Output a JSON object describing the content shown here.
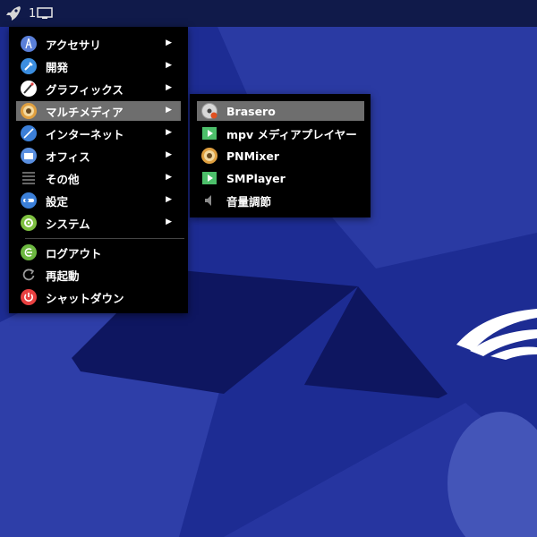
{
  "panel": {
    "launcher_icon": "rocket-icon",
    "workspace_number": "1",
    "workspace_icon": "monitor-icon"
  },
  "main_menu": {
    "items": [
      {
        "label": "アクセサリ",
        "icon": "accessories-compass-icon",
        "has_submenu": true
      },
      {
        "label": "開発",
        "icon": "development-hammer-icon",
        "has_submenu": true
      },
      {
        "label": "グラフィックス",
        "icon": "graphics-brush-icon",
        "has_submenu": true
      },
      {
        "label": "マルチメディア",
        "icon": "multimedia-speaker-icon",
        "has_submenu": true,
        "active": true
      },
      {
        "label": "インターネット",
        "icon": "internet-globe-icon",
        "has_submenu": true
      },
      {
        "label": "オフィス",
        "icon": "office-icon",
        "has_submenu": true
      },
      {
        "label": "その他",
        "icon": "other-list-icon",
        "has_submenu": true
      },
      {
        "label": "設定",
        "icon": "settings-toggle-icon",
        "has_submenu": true
      },
      {
        "label": "システム",
        "icon": "system-gear-icon",
        "has_submenu": true
      }
    ],
    "session_items": [
      {
        "label": "ログアウト",
        "icon": "logout-icon"
      },
      {
        "label": "再起動",
        "icon": "restart-icon"
      },
      {
        "label": "シャットダウン",
        "icon": "power-icon"
      }
    ],
    "submenu_arrow": "▶"
  },
  "sub_menu": {
    "items": [
      {
        "label": "Brasero",
        "icon": "brasero-disc-icon",
        "active": true
      },
      {
        "label": "mpv メディアプレイヤー",
        "icon": "mpv-play-icon"
      },
      {
        "label": "PNMixer",
        "icon": "pnmixer-speaker-icon"
      },
      {
        "label": "SMPlayer",
        "icon": "smplayer-play-icon"
      },
      {
        "label": "音量調節",
        "icon": "volume-speaker-icon"
      }
    ]
  },
  "colors": {
    "desktop_bg": "#1b2a8c",
    "panel_bg": "#101a4a",
    "menu_bg": "#000000",
    "highlight": "#6e6e6e"
  }
}
